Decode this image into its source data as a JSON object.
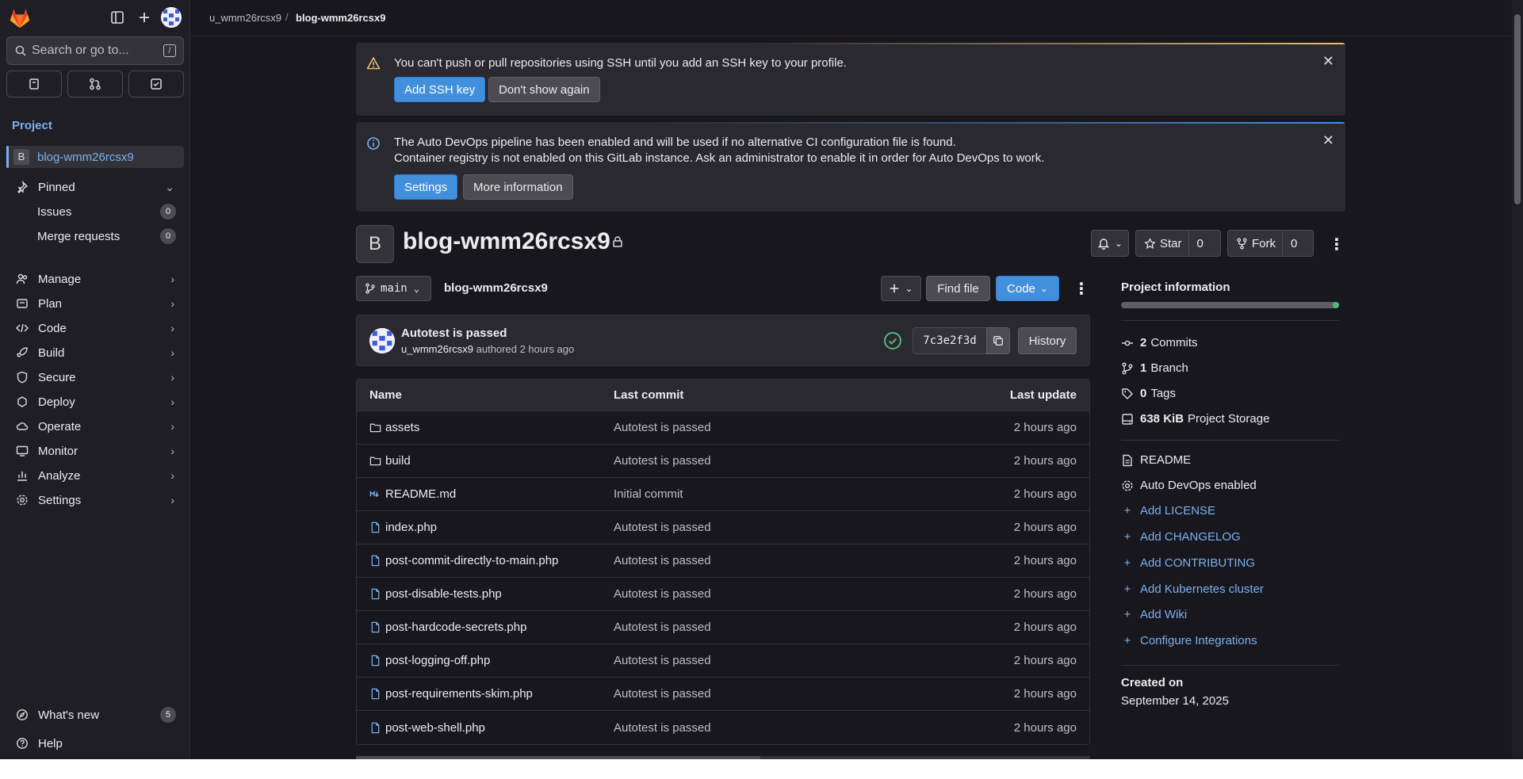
{
  "breadcrumb": {
    "owner": "u_wmm26rcsx9",
    "separator": "/",
    "project": "blog-wmm26rcsx9"
  },
  "search": {
    "placeholder": "Search or go to...",
    "shortcut": "/"
  },
  "sidebar": {
    "section": "Project",
    "project": {
      "initial": "B",
      "name": "blog-wmm26rcsx9"
    },
    "pinned": {
      "label": "Pinned",
      "items": [
        {
          "label": "Issues",
          "count": "0"
        },
        {
          "label": "Merge requests",
          "count": "0"
        }
      ]
    },
    "nav": [
      "Manage",
      "Plan",
      "Code",
      "Build",
      "Secure",
      "Deploy",
      "Operate",
      "Monitor",
      "Analyze",
      "Settings"
    ],
    "whats_new": {
      "label": "What's new",
      "count": "5"
    },
    "help": "Help"
  },
  "alerts": {
    "ssh": {
      "text": "You can't push or pull repositories using SSH until you add an SSH key to your profile.",
      "primary": "Add SSH key",
      "secondary": "Don't show again"
    },
    "devops": {
      "line1": "The Auto DevOps pipeline has been enabled and will be used if no alternative CI configuration file is found.",
      "line2": "Container registry is not enabled on this GitLab instance. Ask an administrator to enable it in order for Auto DevOps to work.",
      "primary": "Settings",
      "secondary": "More information"
    }
  },
  "project": {
    "initial": "B",
    "title": "blog-wmm26rcsx9",
    "star_label": "Star",
    "star_count": "0",
    "fork_label": "Fork",
    "fork_count": "0"
  },
  "repo": {
    "branch": "main",
    "path": "blog-wmm26rcsx9",
    "find_file": "Find file",
    "code_label": "Code"
  },
  "last_commit": {
    "title": "Autotest is passed",
    "author": "u_wmm26rcsx9",
    "meta": "authored 2 hours ago",
    "sha": "7c3e2f3d",
    "history": "History"
  },
  "table": {
    "headers": {
      "name": "Name",
      "commit": "Last commit",
      "update": "Last update"
    },
    "rows": [
      {
        "name": "assets",
        "type": "folder",
        "commit": "Autotest is passed",
        "update": "2 hours ago"
      },
      {
        "name": "build",
        "type": "folder",
        "commit": "Autotest is passed",
        "update": "2 hours ago"
      },
      {
        "name": "README.md",
        "type": "markdown",
        "commit": "Initial commit",
        "update": "2 hours ago"
      },
      {
        "name": "index.php",
        "type": "file",
        "commit": "Autotest is passed",
        "update": "2 hours ago"
      },
      {
        "name": "post-commit-directly-to-main.php",
        "type": "file",
        "commit": "Autotest is passed",
        "update": "2 hours ago"
      },
      {
        "name": "post-disable-tests.php",
        "type": "file",
        "commit": "Autotest is passed",
        "update": "2 hours ago"
      },
      {
        "name": "post-hardcode-secrets.php",
        "type": "file",
        "commit": "Autotest is passed",
        "update": "2 hours ago"
      },
      {
        "name": "post-logging-off.php",
        "type": "file",
        "commit": "Autotest is passed",
        "update": "2 hours ago"
      },
      {
        "name": "post-requirements-skim.php",
        "type": "file",
        "commit": "Autotest is passed",
        "update": "2 hours ago"
      },
      {
        "name": "post-web-shell.php",
        "type": "file",
        "commit": "Autotest is passed",
        "update": "2 hours ago"
      }
    ]
  },
  "project_info": {
    "title": "Project information",
    "commits_count": "2",
    "commits_label": "Commits",
    "branch_count": "1",
    "branch_label": "Branch",
    "tags_count": "0",
    "tags_label": "Tags",
    "storage_size": "638 KiB",
    "storage_label": "Project Storage",
    "readme": "README",
    "devops": "Auto DevOps enabled",
    "links": [
      "Add LICENSE",
      "Add CHANGELOG",
      "Add CONTRIBUTING",
      "Add Kubernetes cluster",
      "Add Wiki",
      "Configure Integrations"
    ],
    "created_label": "Created on",
    "created_date": "September 14, 2025"
  },
  "colors": {
    "accent": "#428fdc",
    "link": "#7bb0ef",
    "success": "#52b87a",
    "warning": "#e9be74",
    "background": "#18171d"
  }
}
